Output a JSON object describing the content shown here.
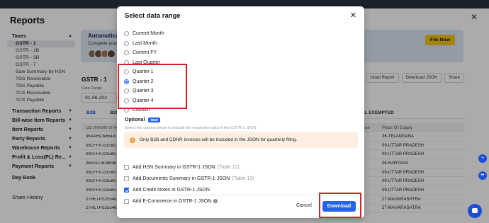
{
  "panel": {
    "title": "Reports"
  },
  "sidebar": {
    "taxes_label": "Taxes",
    "gst_items": [
      "GSTR - 1",
      "GSTR - 2B",
      "GSTR - 3B",
      "GSTR - 7",
      "Sale Summary by HSN",
      "TDS Receivable",
      "TDS Payable",
      "TCS Receivable",
      "TCS Payable"
    ],
    "sections": [
      "Transaction Reports",
      "Bill-wise Item Reports",
      "Item Reports",
      "Party Reports",
      "Warehouse Reports",
      "Profit & Loss(PL) Re...",
      "Payment Reports"
    ],
    "day_book": "Day Book",
    "share_history": "Share History"
  },
  "main": {
    "banner_title": "Automatica",
    "banner_sub": "Complete your",
    "file_now": "File Now",
    "gstr_title": "GSTR - 1",
    "range_label": "Data Range",
    "range_value": "01-06-202",
    "actions": [
      "nload Report",
      "Download JSON",
      "Share"
    ],
    "tabs": [
      "B2B",
      "B2C",
      "NIL EXEMPTED"
    ],
    "columns": [
      "GSTIN/UIN of Re",
      "ue",
      "Place Of Supply"
    ],
    "rows": [
      [
        "36AAHCN6540I",
        "36-TELANGANA"
      ],
      [
        "09CFFPJ3158G1",
        "09-UTTAR PRADESH"
      ],
      [
        "09CFFPJ3158G1",
        "09-UTTAR PRADESH"
      ],
      [
        "06AALCB3689E",
        "06-HARYANA"
      ],
      [
        "09CFFPJ3158G1",
        "09-UTTAR PRADESH"
      ],
      [
        "09CFFPJ3158G1",
        "09-UTTAR PRADESH"
      ],
      [
        "09CFFPJ3158G1",
        "09-UTTAR PRADESH"
      ],
      [
        "27HETPS2554K",
        "27-MAHARASHTRA"
      ],
      [
        "27HETPS2554K",
        "27-MAHARASHTRA"
      ]
    ]
  },
  "modal": {
    "title": "Select data range",
    "options": [
      "Current Month",
      "Last Month",
      "Current FY",
      "Last Quarter",
      "Quarter 1",
      "Quarter 2",
      "Quarter 3",
      "Quarter 4",
      "Custom"
    ],
    "selected_option": "Quarter 2",
    "optional_label": "Optional",
    "new_badge": "NEW",
    "optional_sub": "Select the options below to include the respective data in the GSTR-1 JSON",
    "info_text": "Only B2B and CDNR invoices will be included in the JSON for quarterly filing.",
    "checks": [
      {
        "label": "Add HSN Summary in GSTR-1 JSON",
        "hint": "(Table 12)",
        "checked": false
      },
      {
        "label": "Add Documents Summary in GSTR-1 JSON",
        "hint": "(Table 13)",
        "checked": false
      },
      {
        "label": "Add Credit Notes in GSTR-1 JSON",
        "hint": "",
        "checked": true
      },
      {
        "label": "Add E-Commerce in GSTR-1 JSON",
        "hint": "",
        "checked": false
      }
    ],
    "cancel_label": "Cancel",
    "download_label": "Download"
  },
  "colors": {
    "accent": "#2563eb",
    "highlight": "#d52029",
    "file_now": "#f5c518"
  }
}
